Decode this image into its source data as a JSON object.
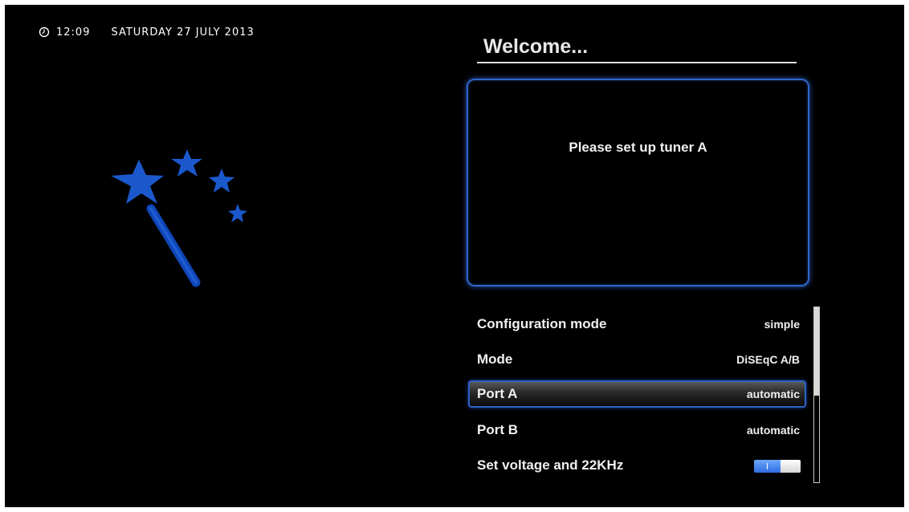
{
  "status_bar": {
    "time": "12:09",
    "date": "SATURDAY 27 JULY 2013"
  },
  "wizard": {
    "title": "Welcome...",
    "info_text": "Please set up tuner A"
  },
  "settings": [
    {
      "label": "Configuration mode",
      "value": "simple"
    },
    {
      "label": "Mode",
      "value": "DiSEqC A/B"
    },
    {
      "label": "Port A",
      "value": "automatic",
      "selected": true
    },
    {
      "label": "Port B",
      "value": "automatic"
    },
    {
      "label": "Set voltage and 22KHz",
      "toggle": true
    }
  ],
  "colors": {
    "accent": "#2d66c9",
    "toggle_on": "#3a78e8",
    "background": "#000000"
  },
  "icons": [
    "clock-icon",
    "magic-wand-icon"
  ]
}
